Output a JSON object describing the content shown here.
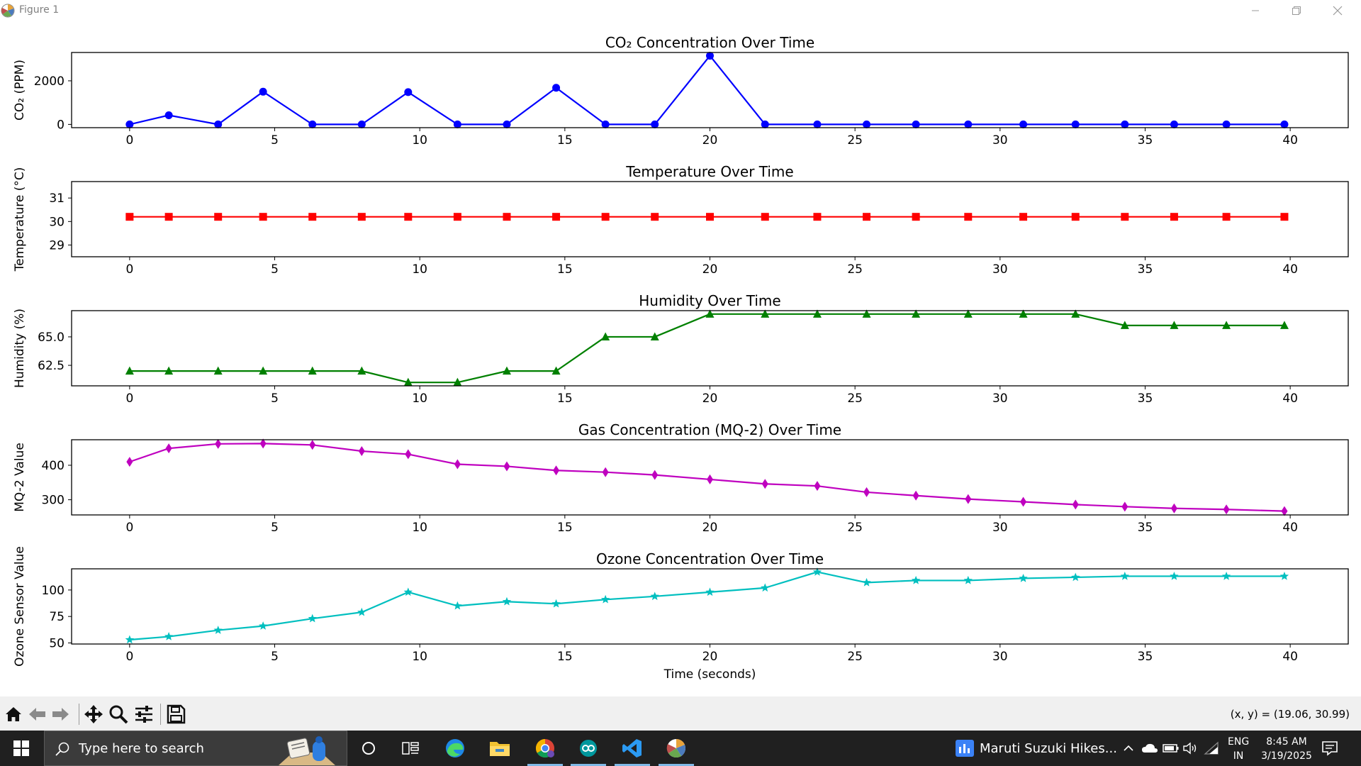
{
  "window": {
    "title": "Figure 1"
  },
  "chart_data": [
    {
      "type": "line",
      "title": "CO₂ Concentration Over Time",
      "xlabel": "",
      "ylabel": "CO₂ (PPM)",
      "color": "#0000ff",
      "marker": "circle",
      "x": [
        0,
        1.35,
        3.05,
        4.6,
        6.3,
        8.0,
        9.6,
        11.3,
        13.0,
        14.7,
        16.4,
        18.1,
        20.0,
        21.9,
        23.7,
        25.4,
        27.1,
        28.9,
        30.8,
        32.6,
        34.3,
        36.0,
        37.8,
        39.8
      ],
      "values": [
        0,
        420,
        0,
        1500,
        0,
        0,
        1480,
        0,
        0,
        1680,
        0,
        0,
        3150,
        0,
        0,
        0,
        0,
        0,
        0,
        0,
        0,
        0,
        0,
        0
      ],
      "xlim": [
        -2,
        42
      ],
      "ylim": [
        -150,
        3300
      ],
      "xticks": [
        0,
        5,
        10,
        15,
        20,
        25,
        30,
        35,
        40
      ],
      "yticks": [
        0,
        2000
      ]
    },
    {
      "type": "line",
      "title": "Temperature Over Time",
      "xlabel": "",
      "ylabel": "Temperature (°C)",
      "color": "#ff0000",
      "marker": "square",
      "x": [
        0,
        1.35,
        3.05,
        4.6,
        6.3,
        8.0,
        9.6,
        11.3,
        13.0,
        14.7,
        16.4,
        18.1,
        20.0,
        21.9,
        23.7,
        25.4,
        27.1,
        28.9,
        30.8,
        32.6,
        34.3,
        36.0,
        37.8,
        39.8
      ],
      "values": [
        30.2,
        30.2,
        30.2,
        30.2,
        30.2,
        30.2,
        30.2,
        30.2,
        30.2,
        30.2,
        30.2,
        30.2,
        30.2,
        30.2,
        30.2,
        30.2,
        30.2,
        30.2,
        30.2,
        30.2,
        30.2,
        30.2,
        30.2,
        30.2
      ],
      "xlim": [
        -2,
        42
      ],
      "ylim": [
        28.5,
        31.7
      ],
      "xticks": [
        0,
        5,
        10,
        15,
        20,
        25,
        30,
        35,
        40
      ],
      "yticks": [
        29,
        30,
        31
      ]
    },
    {
      "type": "line",
      "title": "Humidity Over Time",
      "xlabel": "",
      "ylabel": "Humidity (%)",
      "color": "#008000",
      "marker": "triangle",
      "x": [
        0,
        1.35,
        3.05,
        4.6,
        6.3,
        8.0,
        9.6,
        11.3,
        13.0,
        14.7,
        16.4,
        18.1,
        20.0,
        21.9,
        23.7,
        25.4,
        27.1,
        28.9,
        30.8,
        32.6,
        34.3,
        36.0,
        37.8,
        39.8
      ],
      "values": [
        62.0,
        62.0,
        62.0,
        62.0,
        62.0,
        62.0,
        61.0,
        61.0,
        62.0,
        62.0,
        65.0,
        65.0,
        67.0,
        67.0,
        67.0,
        67.0,
        67.0,
        67.0,
        67.0,
        67.0,
        66.0,
        66.0,
        66.0,
        66.0
      ],
      "xlim": [
        -2,
        42
      ],
      "ylim": [
        60.7,
        67.3
      ],
      "xticks": [
        0,
        5,
        10,
        15,
        20,
        25,
        30,
        35,
        40
      ],
      "yticks": [
        62.5,
        65.0
      ],
      "ytick_labels": [
        "62.5",
        "65.0"
      ]
    },
    {
      "type": "line",
      "title": "Gas Concentration (MQ-2) Over Time",
      "xlabel": "",
      "ylabel": "MQ-2 Value",
      "color": "#bf00bf",
      "marker": "diamond",
      "x": [
        0,
        1.35,
        3.05,
        4.6,
        6.3,
        8.0,
        9.6,
        11.3,
        13.0,
        14.7,
        16.4,
        18.1,
        20.0,
        21.9,
        23.7,
        25.4,
        27.1,
        28.9,
        30.8,
        32.6,
        34.3,
        36.0,
        37.8,
        39.8
      ],
      "values": [
        410,
        449,
        462,
        463,
        459,
        441,
        432,
        403,
        397,
        385,
        380,
        372,
        359,
        346,
        340,
        322,
        312,
        302,
        294,
        286,
        280,
        275,
        272,
        267
      ],
      "xlim": [
        -2,
        42
      ],
      "ylim": [
        256,
        474
      ],
      "xticks": [
        0,
        5,
        10,
        15,
        20,
        25,
        30,
        35,
        40
      ],
      "yticks": [
        300,
        400
      ]
    },
    {
      "type": "line",
      "title": "Ozone Concentration Over Time",
      "xlabel": "Time (seconds)",
      "ylabel": "Ozone Sensor Value",
      "color": "#00bfbf",
      "marker": "star",
      "x": [
        0,
        1.35,
        3.05,
        4.6,
        6.3,
        8.0,
        9.6,
        11.3,
        13.0,
        14.7,
        16.4,
        18.1,
        20.0,
        21.9,
        23.7,
        25.4,
        27.1,
        28.9,
        30.8,
        32.6,
        34.3,
        36.0,
        37.8,
        39.8
      ],
      "values": [
        53,
        56,
        62,
        66,
        73,
        79,
        98,
        85,
        89,
        87,
        91,
        94,
        98,
        102,
        117,
        107,
        109,
        109,
        111,
        112,
        113,
        113,
        113,
        113
      ],
      "xlim": [
        -2,
        42
      ],
      "ylim": [
        49,
        120
      ],
      "xticks": [
        0,
        5,
        10,
        15,
        20,
        25,
        30,
        35,
        40
      ],
      "yticks": [
        50,
        75,
        100
      ]
    }
  ],
  "toolbar": {
    "coords": "(x, y) = (19.06, 30.99)",
    "buttons": [
      "home-icon",
      "back-arrow-icon",
      "forward-arrow-icon",
      "pan-move-icon",
      "zoom-magnifier-icon",
      "configure-subplots-icon",
      "save-floppy-icon"
    ]
  },
  "taskbar": {
    "search_placeholder": "Type here to search",
    "news_text": "Maruti Suzuki Hikes...",
    "lang_line1": "ENG",
    "lang_line2": "IN",
    "time": "8:45 AM",
    "date": "3/19/2025"
  }
}
